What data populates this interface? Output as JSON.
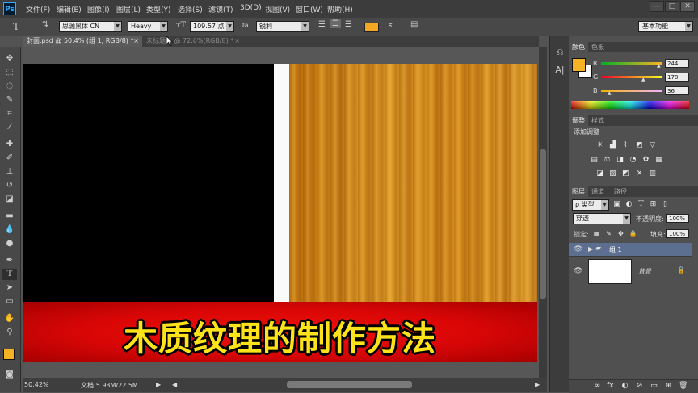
{
  "app": {
    "logo": "Ps"
  },
  "menu": [
    "文件(F)",
    "编辑(E)",
    "图像(I)",
    "图层(L)",
    "类型(Y)",
    "选择(S)",
    "滤镜(T)",
    "3D(D)",
    "视图(V)",
    "窗口(W)",
    "帮助(H)"
  ],
  "window_controls": {
    "minimize": "—",
    "restore": "□",
    "close": "✕"
  },
  "options": {
    "tool_icon": "T",
    "font_family": "思源黑体 CN",
    "font_style": "Heavy",
    "font_size": "109.57 点",
    "aa_label": "ªa",
    "antialias": "锐利",
    "text_color": "#f5a623",
    "workspace": "基本功能"
  },
  "tabs": [
    {
      "label": "封面.psd @ 50.4% (组 1, RGB/8) *",
      "close": "×",
      "active": true
    },
    {
      "label": "未标题-1 @ 72.6%(RGB/8) *",
      "close": "×",
      "active": false
    }
  ],
  "canvas": {
    "banner_text": "木质纹理的制作方法"
  },
  "status": {
    "zoom": "50.42%",
    "doc": "文档:5.93M/22.5M"
  },
  "color_panel": {
    "tabs": [
      "颜色",
      "色板"
    ],
    "channels": [
      {
        "name": "R",
        "value": "244"
      },
      {
        "name": "G",
        "value": "178"
      },
      {
        "name": "B",
        "value": "36"
      }
    ],
    "foreground": "#f4b224",
    "background": "#ffffff"
  },
  "adjust_panel": {
    "tabs": [
      "调整",
      "样式"
    ],
    "title": "添加调整"
  },
  "layers_panel": {
    "tabs": [
      "图层",
      "通道",
      "路径"
    ],
    "kind_label": "ρ 类型",
    "blend_mode": "穿透",
    "opacity_label": "不透明度:",
    "opacity": "100%",
    "lock_label": "锁定:",
    "fill_label": "填充:",
    "fill": "100%",
    "layers": [
      {
        "name": "组 1",
        "type": "group",
        "selected": true
      },
      {
        "name": "背景",
        "type": "background",
        "selected": false
      }
    ],
    "footer_icons": [
      "∞",
      "fx",
      "◐",
      "⊘",
      "▭",
      "⊕",
      "🗑"
    ]
  }
}
